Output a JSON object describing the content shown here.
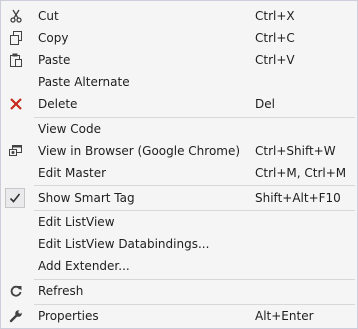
{
  "menu": {
    "cut": {
      "label": "Cut",
      "shortcut": "Ctrl+X",
      "icon": "scissors-icon"
    },
    "copy": {
      "label": "Copy",
      "shortcut": "Ctrl+C",
      "icon": "copy-icon"
    },
    "paste": {
      "label": "Paste",
      "shortcut": "Ctrl+V",
      "icon": "paste-icon"
    },
    "paste_alternate": {
      "label": "Paste Alternate"
    },
    "delete": {
      "label": "Delete",
      "shortcut": "Del",
      "icon": "delete-x-icon",
      "icon_color": "#c42b1c"
    },
    "view_code": {
      "label": "View Code"
    },
    "view_in_browser": {
      "label": "View in Browser (Google Chrome)",
      "shortcut": "Ctrl+Shift+W",
      "icon": "browser-icon"
    },
    "edit_master": {
      "label": "Edit Master",
      "shortcut": "Ctrl+M, Ctrl+M"
    },
    "show_smart_tag": {
      "label": "Show Smart Tag",
      "shortcut": "Shift+Alt+F10",
      "icon": "checkmark-icon",
      "checked": true
    },
    "edit_listview": {
      "label": "Edit ListView"
    },
    "edit_listview_databindings": {
      "label": "Edit ListView Databindings..."
    },
    "add_extender": {
      "label": "Add Extender..."
    },
    "refresh": {
      "label": "Refresh",
      "icon": "refresh-icon"
    },
    "properties": {
      "label": "Properties",
      "shortcut": "Alt+Enter",
      "icon": "wrench-icon"
    }
  }
}
